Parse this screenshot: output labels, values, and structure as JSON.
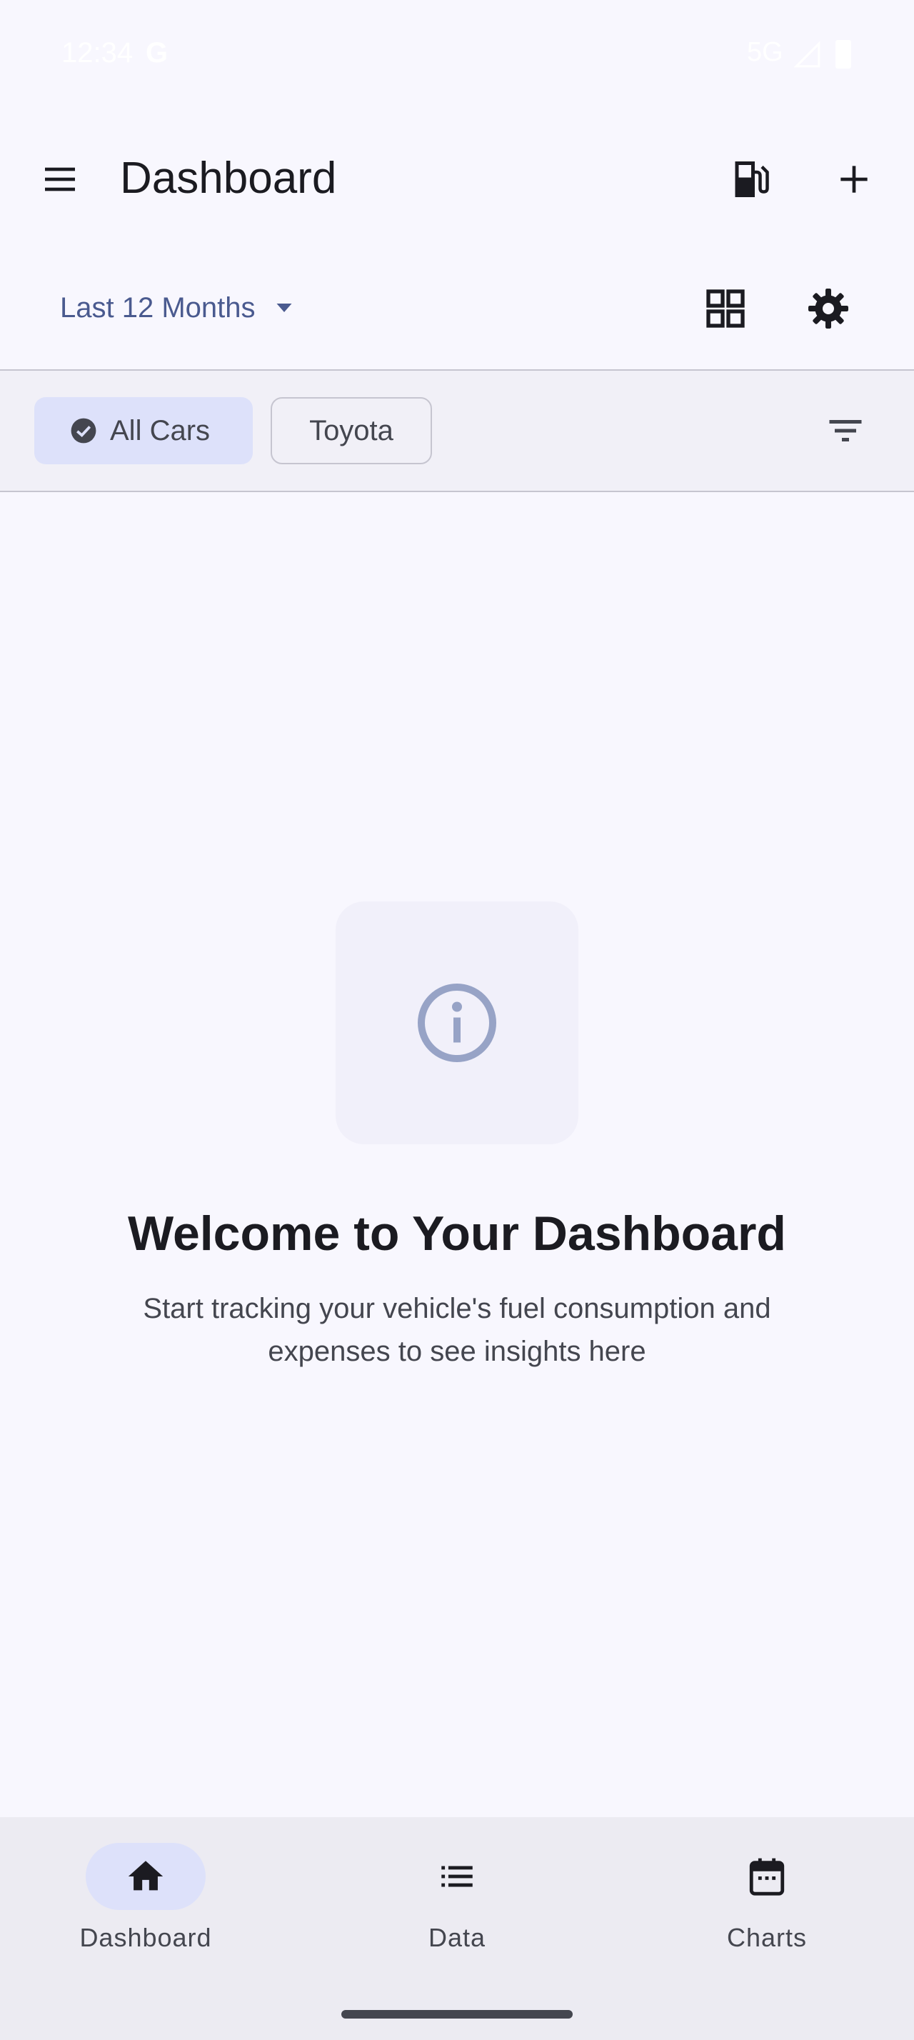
{
  "status_bar": {
    "time": "12:34",
    "carrier_logo": "G",
    "network": "5G"
  },
  "app_bar": {
    "title": "Dashboard",
    "menu_icon": "menu-icon",
    "fuel_icon": "fuel-pump-icon",
    "add_icon": "plus-icon"
  },
  "toolbar": {
    "period_label": "Last 12 Months",
    "grid_icon": "grid-view-icon",
    "settings_icon": "gear-icon"
  },
  "filters": {
    "chips": [
      {
        "label": "All Cars",
        "selected": true
      },
      {
        "label": "Toyota",
        "selected": false
      }
    ],
    "filter_icon": "filter-icon"
  },
  "empty_state": {
    "icon": "info-icon",
    "title": "Welcome to Your Dashboard",
    "message": "Start tracking your vehicle's fuel consumption and expenses to see insights here"
  },
  "bottom_nav": {
    "items": [
      {
        "label": "Dashboard",
        "icon": "home-icon",
        "active": true
      },
      {
        "label": "Data",
        "icon": "list-icon",
        "active": false
      },
      {
        "label": "Charts",
        "icon": "calendar-icon",
        "active": false
      }
    ]
  },
  "colors": {
    "background": "#f8f7fe",
    "accent": "#4a5a8f",
    "chip_selected": "#dde1fa",
    "nav_background": "#ecebf2",
    "info_icon": "#97a3c6"
  }
}
